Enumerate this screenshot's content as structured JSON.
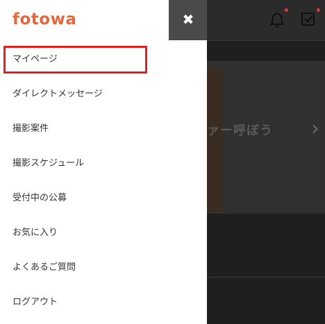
{
  "app": {
    "logo_text": "fotowa",
    "brand_color": "#e8663c"
  },
  "header": {
    "close_label": "✖",
    "notification_icon": "bell-icon",
    "task_icon": "checkbox-icon",
    "badge_color": "#d13b3b"
  },
  "background": {
    "hero_text": "ァー呼ぼう",
    "next_chevron": "›"
  },
  "menu": {
    "items": [
      {
        "label": "マイページ",
        "highlighted": true
      },
      {
        "label": "ダイレクトメッセージ"
      },
      {
        "label": "撮影案件"
      },
      {
        "label": "撮影スケジュール"
      },
      {
        "label": "受付中の公募"
      },
      {
        "label": "お気に入り"
      },
      {
        "label": "よくあるご質問"
      },
      {
        "label": "ログアウト"
      }
    ],
    "highlight_color": "#e0211d"
  }
}
